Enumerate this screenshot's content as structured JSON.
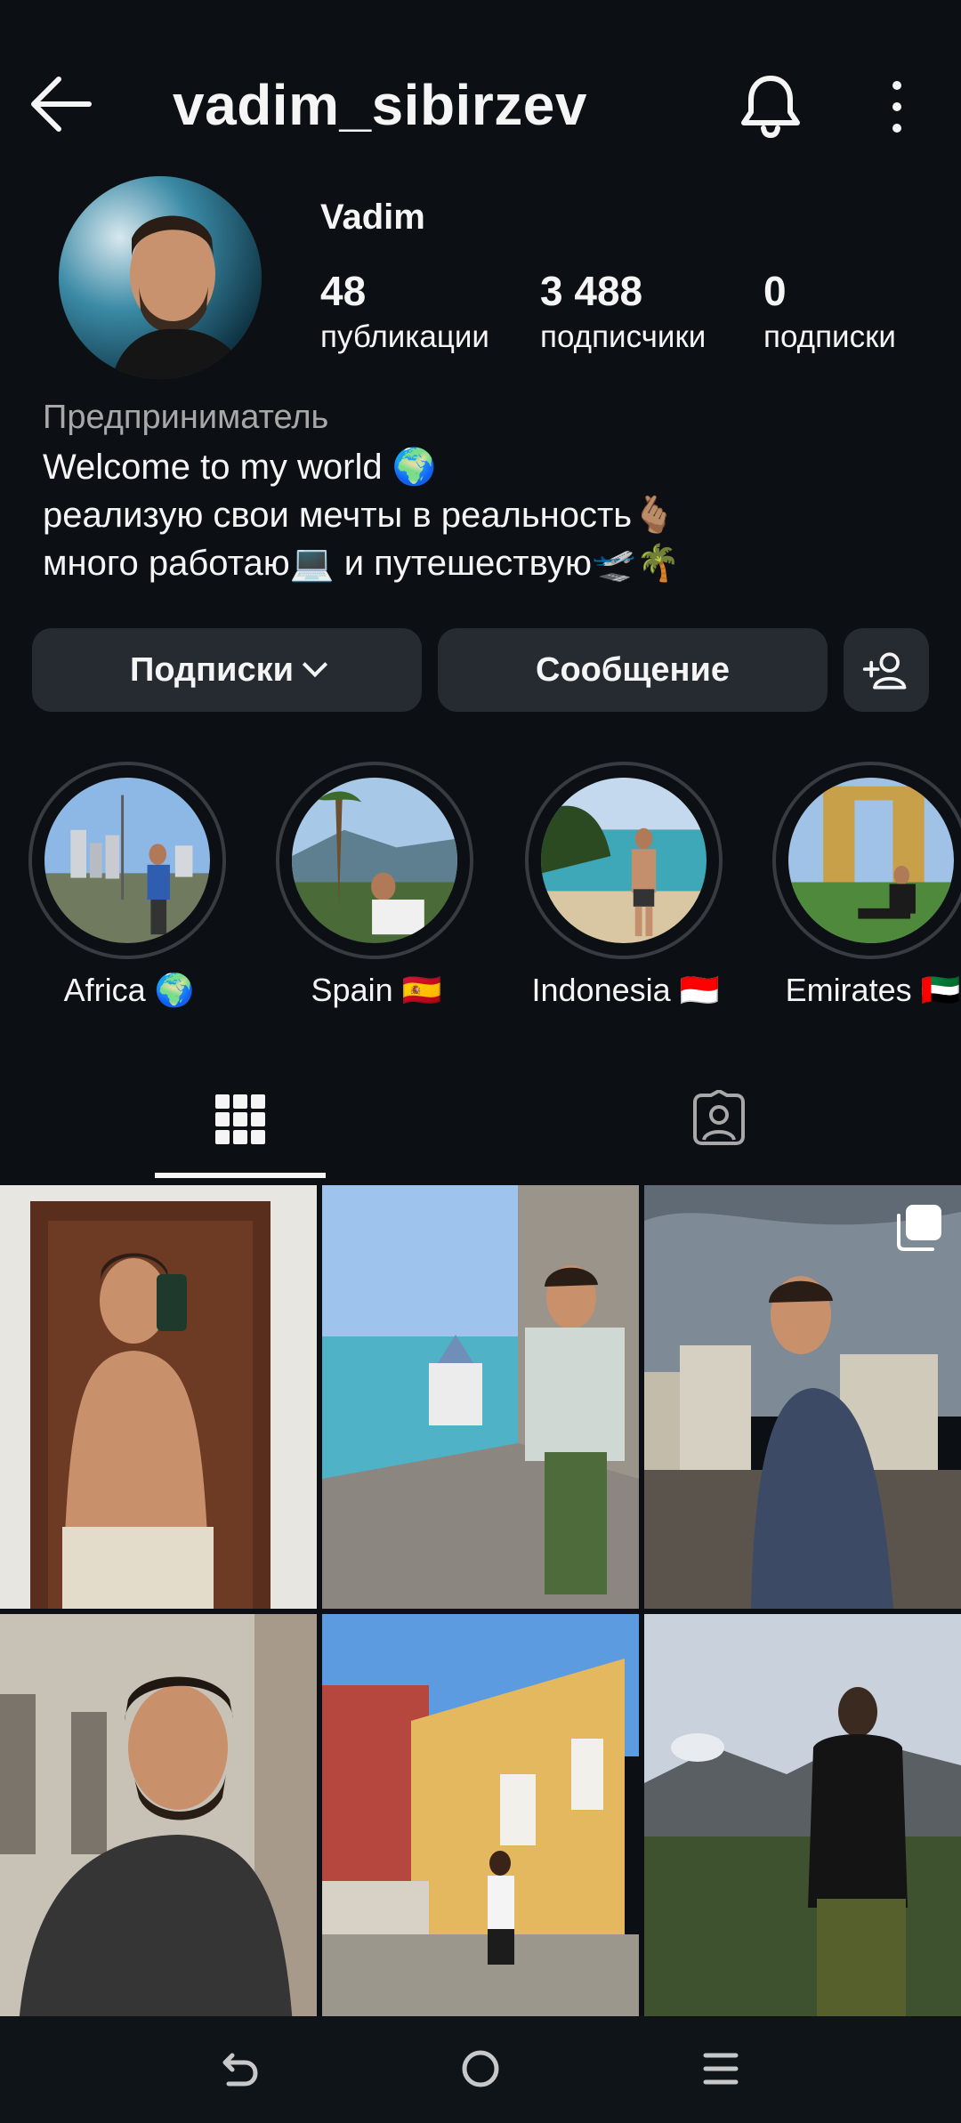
{
  "header": {
    "username": "vadim_sibirzev"
  },
  "profile": {
    "display_name": "Vadim",
    "stats": [
      {
        "value": "48",
        "label": "публикации"
      },
      {
        "value": "3 488",
        "label": "подписчики"
      },
      {
        "value": "0",
        "label": "подписки"
      }
    ],
    "category": "Предприниматель",
    "bio": [
      "Welcome to my world 🌍",
      "реализую свои мечты в реальность🫰🏽",
      "много работаю💻 и путешествую🛫🌴"
    ]
  },
  "actions": {
    "follow_label": "Подписки",
    "message_label": "Сообщение"
  },
  "highlights": [
    {
      "label": "Africa 🌍"
    },
    {
      "label": "Spain 🇪🇸"
    },
    {
      "label": "Indonesia 🇮🇩"
    },
    {
      "label": "Emirates 🇦🇪"
    }
  ],
  "tabs": [
    {
      "icon": "grid-icon"
    },
    {
      "icon": "tagged-icon"
    }
  ],
  "colors": {
    "background": "#0c1014",
    "button": "#262a31",
    "muted": "#a8a8a8"
  }
}
